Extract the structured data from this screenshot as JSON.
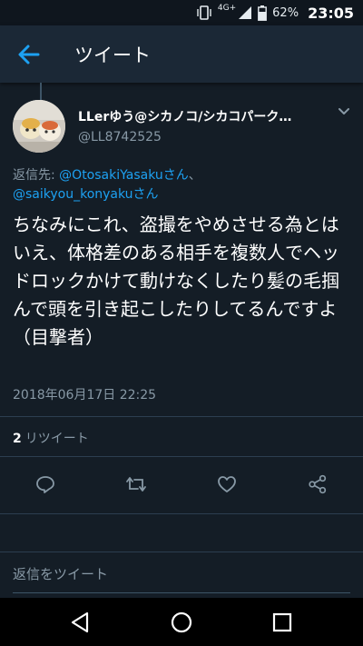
{
  "status_bar": {
    "network": "4G+",
    "battery_percent": "62%",
    "time": "23:05"
  },
  "app_bar": {
    "title": "ツイート"
  },
  "tweet": {
    "author_name": "LLerゆう@シカノコ/シカコパーク…",
    "author_handle": "@LL8742525",
    "reply_prefix": "返信先: ",
    "reply_mention_1": "@OtosakiYasakuさん",
    "reply_separator": "、",
    "reply_mention_2": "@saikyou_konyakuさん",
    "text": "ちなみにこれ、盗撮をやめさせる為とはいえ、体格差のある相手を複数人でヘッドロックかけて動けなくしたり髪の毛掴んで頭を引き起こしたりしてるんですよ（目撃者）",
    "timestamp": "2018年06月17日 22:25",
    "retweet_count": "2",
    "retweet_label": "リツイート"
  },
  "compose": {
    "placeholder": "返信をツイート"
  },
  "icons": {
    "back": "arrow-left-icon",
    "reply": "reply-icon",
    "retweet": "retweet-icon",
    "like": "heart-icon",
    "share": "share-icon"
  },
  "colors": {
    "background": "#141d26",
    "app_bar": "#1b2836",
    "accent": "#1da1f2",
    "secondary_text": "#8899a6"
  }
}
